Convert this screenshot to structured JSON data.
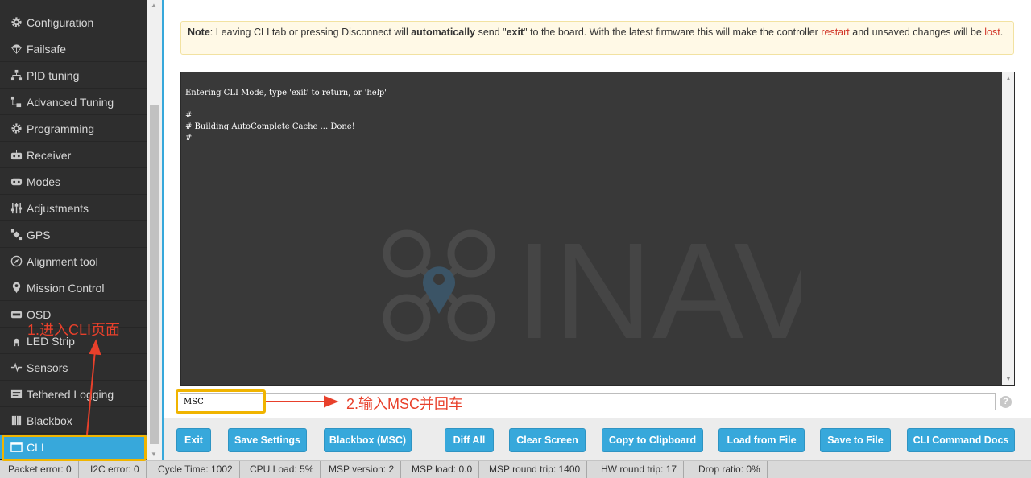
{
  "sidebar": {
    "items": [
      {
        "label": "Configuration",
        "icon": "gear-icon"
      },
      {
        "label": "Failsafe",
        "icon": "parachute-icon"
      },
      {
        "label": "PID tuning",
        "icon": "pid-icon"
      },
      {
        "label": "Advanced Tuning",
        "icon": "advanced-tuning-icon"
      },
      {
        "label": "Programming",
        "icon": "gear-icon"
      },
      {
        "label": "Receiver",
        "icon": "receiver-icon"
      },
      {
        "label": "Modes",
        "icon": "modes-icon"
      },
      {
        "label": "Adjustments",
        "icon": "sliders-icon"
      },
      {
        "label": "GPS",
        "icon": "satellite-icon"
      },
      {
        "label": "Alignment tool",
        "icon": "compass-icon"
      },
      {
        "label": "Mission Control",
        "icon": "map-pin-icon"
      },
      {
        "label": "OSD",
        "icon": "osd-icon"
      },
      {
        "label": "LED Strip",
        "icon": "led-icon"
      },
      {
        "label": "Sensors",
        "icon": "pulse-icon"
      },
      {
        "label": "Tethered Logging",
        "icon": "logging-icon"
      },
      {
        "label": "Blackbox",
        "icon": "blackbox-icon"
      },
      {
        "label": "CLI",
        "icon": "cli-icon",
        "active": true
      }
    ]
  },
  "note": {
    "label": "Note",
    "text1": ": Leaving CLI tab or pressing Disconnect will ",
    "bold1": "automatically",
    "text2": " send \"",
    "bold2": "exit",
    "text3": "\" to the board. With the latest firmware this will make the controller ",
    "red1": "restart",
    "text4": " and unsaved changes will be ",
    "red2": "lost",
    "text5": "."
  },
  "cli": {
    "lines": [
      "Entering CLI Mode, type 'exit' to return, or 'help'",
      "",
      "#",
      "# Building AutoComplete Cache ... Done!",
      "#"
    ],
    "input_value": "MSC",
    "watermark_text": "INAV"
  },
  "help_icon": "?",
  "toolbar": {
    "buttons": [
      "Exit",
      "Save Settings",
      "Blackbox (MSC)",
      "Diff All",
      "Clear Screen",
      "Copy to Clipboard",
      "Load from File",
      "Save to File",
      "CLI Command Docs"
    ]
  },
  "status": {
    "items": [
      "Packet error: 0",
      "I2C error: 0",
      "Cycle Time: 1002",
      "CPU Load: 5%",
      "MSP version: 2",
      "MSP load: 0.0",
      "MSP round trip: 1400",
      "HW round trip: 17",
      "Drop ratio: 0%"
    ]
  },
  "annotations": {
    "step1": "1.进入CLI页面",
    "step2": "2.输入MSC并回车"
  },
  "colors": {
    "accent": "#37a8db",
    "highlight": "#f0b400",
    "annotation": "#e8402b",
    "cli_background": "#393939"
  }
}
